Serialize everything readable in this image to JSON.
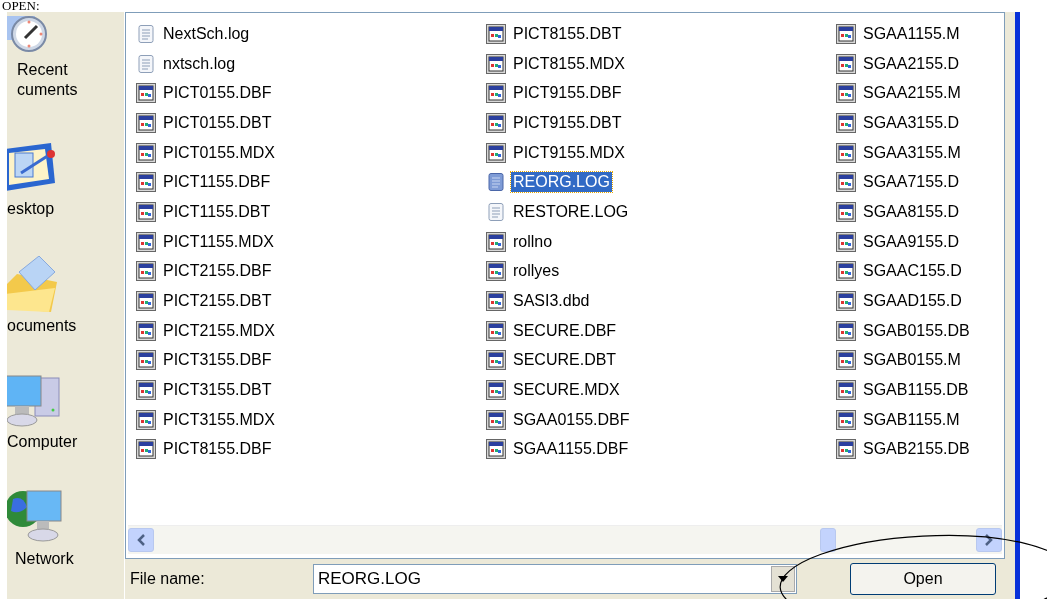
{
  "heading": "OPEN:",
  "places": [
    {
      "lines": [
        "Recent",
        "cuments"
      ],
      "kind": "recent"
    },
    {
      "lines": [
        "esktop"
      ],
      "kind": "desktop"
    },
    {
      "lines": [
        "ocuments"
      ],
      "kind": "documents"
    },
    {
      "lines": [
        "Computer"
      ],
      "kind": "computer"
    },
    {
      "lines": [
        "Network"
      ],
      "kind": "network"
    }
  ],
  "files": [
    [
      {
        "name": "NextSch.log",
        "kind": "text",
        "selected": false
      },
      {
        "name": "nxtsch.log",
        "kind": "text",
        "selected": false
      },
      {
        "name": "PICT0155.DBF",
        "kind": "app",
        "selected": false
      },
      {
        "name": "PICT0155.DBT",
        "kind": "app",
        "selected": false
      },
      {
        "name": "PICT0155.MDX",
        "kind": "app",
        "selected": false
      },
      {
        "name": "PICT1155.DBF",
        "kind": "app",
        "selected": false
      },
      {
        "name": "PICT1155.DBT",
        "kind": "app",
        "selected": false
      },
      {
        "name": "PICT1155.MDX",
        "kind": "app",
        "selected": false
      },
      {
        "name": "PICT2155.DBF",
        "kind": "app",
        "selected": false
      },
      {
        "name": "PICT2155.DBT",
        "kind": "app",
        "selected": false
      },
      {
        "name": "PICT2155.MDX",
        "kind": "app",
        "selected": false
      },
      {
        "name": "PICT3155.DBF",
        "kind": "app",
        "selected": false
      },
      {
        "name": "PICT3155.DBT",
        "kind": "app",
        "selected": false
      },
      {
        "name": "PICT3155.MDX",
        "kind": "app",
        "selected": false
      },
      {
        "name": "PICT8155.DBF",
        "kind": "app",
        "selected": false
      }
    ],
    [
      {
        "name": "PICT8155.DBT",
        "kind": "app",
        "selected": false
      },
      {
        "name": "PICT8155.MDX",
        "kind": "app",
        "selected": false
      },
      {
        "name": "PICT9155.DBF",
        "kind": "app",
        "selected": false
      },
      {
        "name": "PICT9155.DBT",
        "kind": "app",
        "selected": false
      },
      {
        "name": "PICT9155.MDX",
        "kind": "app",
        "selected": false
      },
      {
        "name": "REORG.LOG",
        "kind": "text",
        "selected": true
      },
      {
        "name": "RESTORE.LOG",
        "kind": "text",
        "selected": false
      },
      {
        "name": "rollno",
        "kind": "app",
        "selected": false
      },
      {
        "name": "rollyes",
        "kind": "app",
        "selected": false
      },
      {
        "name": "SASI3.dbd",
        "kind": "app",
        "selected": false
      },
      {
        "name": "SECURE.DBF",
        "kind": "app",
        "selected": false
      },
      {
        "name": "SECURE.DBT",
        "kind": "app",
        "selected": false
      },
      {
        "name": "SECURE.MDX",
        "kind": "app",
        "selected": false
      },
      {
        "name": "SGAA0155.DBF",
        "kind": "app",
        "selected": false
      },
      {
        "name": "SGAA1155.DBF",
        "kind": "app",
        "selected": false
      }
    ],
    [
      {
        "name": "SGAA1155.M",
        "kind": "app",
        "selected": false
      },
      {
        "name": "SGAA2155.D",
        "kind": "app",
        "selected": false
      },
      {
        "name": "SGAA2155.M",
        "kind": "app",
        "selected": false
      },
      {
        "name": "SGAA3155.D",
        "kind": "app",
        "selected": false
      },
      {
        "name": "SGAA3155.M",
        "kind": "app",
        "selected": false
      },
      {
        "name": "SGAA7155.D",
        "kind": "app",
        "selected": false
      },
      {
        "name": "SGAA8155.D",
        "kind": "app",
        "selected": false
      },
      {
        "name": "SGAA9155.D",
        "kind": "app",
        "selected": false
      },
      {
        "name": "SGAAC155.D",
        "kind": "app",
        "selected": false
      },
      {
        "name": "SGAAD155.D",
        "kind": "app",
        "selected": false
      },
      {
        "name": "SGAB0155.DB",
        "kind": "app",
        "selected": false
      },
      {
        "name": "SGAB0155.M",
        "kind": "app",
        "selected": false
      },
      {
        "name": "SGAB1155.DB",
        "kind": "app",
        "selected": false
      },
      {
        "name": "SGAB1155.M",
        "kind": "app",
        "selected": false
      },
      {
        "name": "SGAB2155.DB",
        "kind": "app",
        "selected": false
      }
    ]
  ],
  "file_name": {
    "label": "File name:",
    "value": "REORG.LOG"
  },
  "open_button": "Open"
}
